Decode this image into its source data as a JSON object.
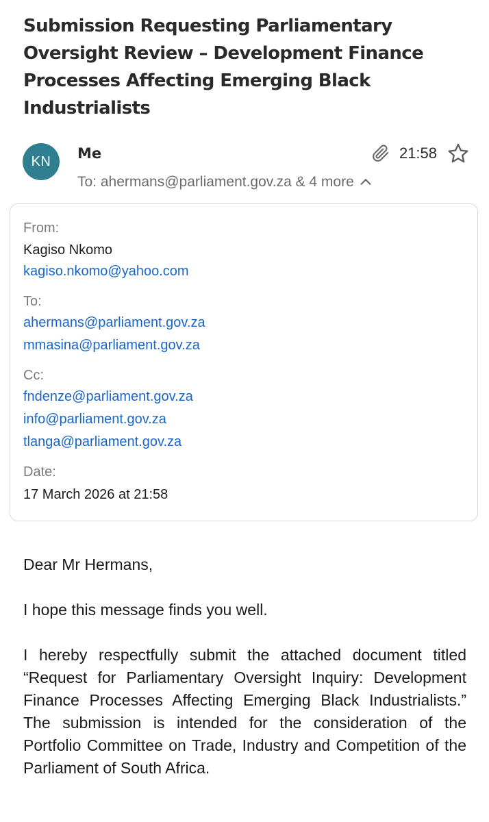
{
  "email": {
    "subject": "Submission Requesting Parliamentary Oversight Review – Development Finance Processes Affecting Emerging Black Industrialists",
    "header": {
      "avatar_initials": "KN",
      "sender_label": "Me",
      "time": "21:58",
      "recipients_summary": "To: ahermans@parliament.gov.za & 4 more"
    },
    "details": {
      "from_label": "From:",
      "from_name": "Kagiso Nkomo",
      "from_email": "kagiso.nkomo@yahoo.com",
      "to_label": "To:",
      "to": [
        "ahermans@parliament.gov.za",
        "mmasina@parliament.gov.za"
      ],
      "cc_label": "Cc:",
      "cc": [
        "fndenze@parliament.gov.za",
        "info@parliament.gov.za",
        "tlanga@parliament.gov.za"
      ],
      "date_label": "Date:",
      "date": "17 March 2026 at 21:58"
    },
    "body": {
      "greeting": "Dear Mr Hermans,",
      "paragraph1": "I hope this message finds you well.",
      "paragraph2": "I hereby respectfully submit the attached document titled “Request for Parliamentary Oversight Inquiry: Development Finance Processes Affecting Emerging Black Industrialists.” The submission is intended for the consideration of the Portfolio Committee on Trade, Industry and Competition of the Parliament of South Africa."
    }
  },
  "icons": {
    "attachment": "paperclip-icon",
    "favorite": "star-icon",
    "collapse": "chevron-up-icon"
  },
  "colors": {
    "avatar_bg": "#2f7f91",
    "link": "#1a66c8",
    "muted": "#7a7a7f"
  }
}
